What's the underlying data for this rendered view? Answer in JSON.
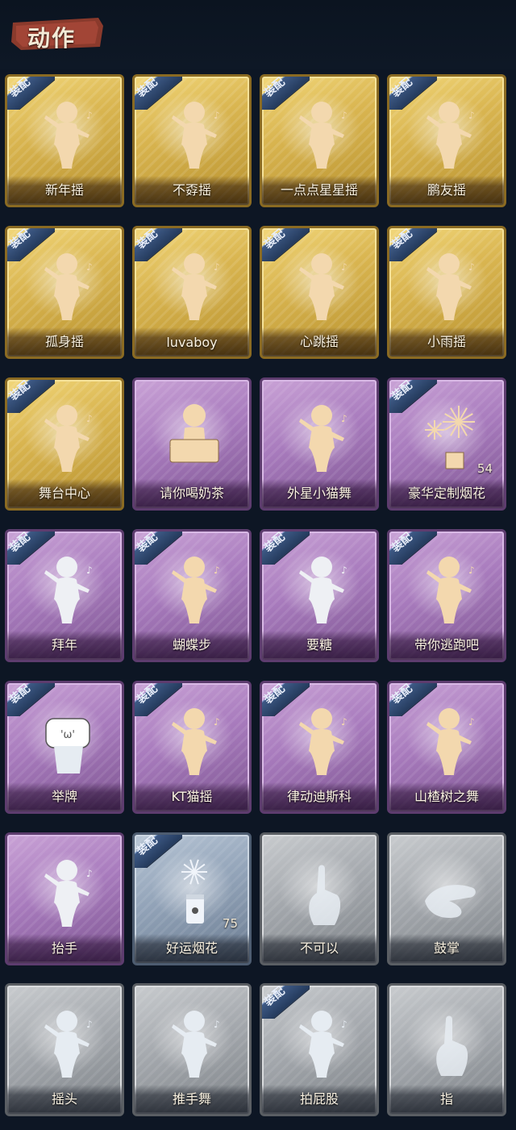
{
  "header": {
    "title": "动作"
  },
  "badge_text": "装配",
  "colors": {
    "gold": "#d9b550",
    "purple": "#a87bbd",
    "blue": "#92a3b8",
    "grey": "#a4a8ad",
    "badge": "#2f4a72",
    "background": "#0d1624"
  },
  "cards": [
    {
      "label": "新年摇",
      "rarity": "gold",
      "equipped": true,
      "icon": "dance-figure-icon",
      "count": ""
    },
    {
      "label": "不孬摇",
      "rarity": "gold",
      "equipped": true,
      "icon": "dance-figure-icon",
      "count": ""
    },
    {
      "label": "一点点星星摇",
      "rarity": "gold",
      "equipped": true,
      "icon": "dance-figure-icon",
      "count": ""
    },
    {
      "label": "鹏友摇",
      "rarity": "gold",
      "equipped": true,
      "icon": "dance-figure-icon",
      "count": ""
    },
    {
      "label": "孤身摇",
      "rarity": "gold",
      "equipped": true,
      "icon": "dance-figure-icon",
      "count": ""
    },
    {
      "label": "luvaboy",
      "rarity": "gold",
      "equipped": true,
      "icon": "dance-figure-icon",
      "count": ""
    },
    {
      "label": "心跳摇",
      "rarity": "gold",
      "equipped": true,
      "icon": "dance-figure-icon",
      "count": ""
    },
    {
      "label": "小雨摇",
      "rarity": "gold",
      "equipped": true,
      "icon": "dance-figure-icon",
      "count": ""
    },
    {
      "label": "舞台中心",
      "rarity": "gold",
      "equipped": true,
      "icon": "dance-figure-icon",
      "count": ""
    },
    {
      "label": "请你喝奶茶",
      "rarity": "purple",
      "equipped": false,
      "icon": "milk-tea-figure-icon",
      "count": ""
    },
    {
      "label": "外星小猫舞",
      "rarity": "purple",
      "equipped": false,
      "icon": "dance-figure-icon",
      "count": ""
    },
    {
      "label": "豪华定制烟花",
      "rarity": "purple",
      "equipped": true,
      "icon": "fireworks-icon",
      "count": "54"
    },
    {
      "label": "拜年",
      "rarity": "purple",
      "equipped": true,
      "icon": "greeting-figure-icon",
      "count": ""
    },
    {
      "label": "蝴蝶步",
      "rarity": "purple",
      "equipped": true,
      "icon": "dance-figure-icon",
      "count": ""
    },
    {
      "label": "要糖",
      "rarity": "purple",
      "equipped": true,
      "icon": "greeting-figure-icon",
      "count": ""
    },
    {
      "label": "带你逃跑吧",
      "rarity": "purple",
      "equipped": true,
      "icon": "dance-figure-icon",
      "count": ""
    },
    {
      "label": "举牌",
      "rarity": "purple",
      "equipped": true,
      "icon": "sign-figure-icon",
      "count": ""
    },
    {
      "label": "KT猫摇",
      "rarity": "purple",
      "equipped": true,
      "icon": "dance-figure-icon",
      "count": ""
    },
    {
      "label": "律动迪斯科",
      "rarity": "purple",
      "equipped": true,
      "icon": "dance-figure-icon",
      "count": ""
    },
    {
      "label": "山楂树之舞",
      "rarity": "purple",
      "equipped": true,
      "icon": "dance-figure-icon",
      "count": ""
    },
    {
      "label": "抬手",
      "rarity": "purple",
      "equipped": false,
      "icon": "greeting-figure-icon",
      "count": ""
    },
    {
      "label": "好运烟花",
      "rarity": "blue",
      "equipped": true,
      "icon": "firework-can-icon",
      "count": "75"
    },
    {
      "label": "不可以",
      "rarity": "grey",
      "equipped": false,
      "icon": "hand-icon",
      "count": ""
    },
    {
      "label": "鼓掌",
      "rarity": "grey",
      "equipped": false,
      "icon": "clap-hands-icon",
      "count": ""
    },
    {
      "label": "摇头",
      "rarity": "grey",
      "equipped": false,
      "icon": "greeting-figure-icon",
      "count": ""
    },
    {
      "label": "推手舞",
      "rarity": "grey",
      "equipped": false,
      "icon": "greeting-figure-icon",
      "count": ""
    },
    {
      "label": "拍屁股",
      "rarity": "grey",
      "equipped": true,
      "icon": "greeting-figure-icon",
      "count": ""
    },
    {
      "label": "指",
      "rarity": "grey",
      "equipped": false,
      "icon": "hand-icon",
      "count": ""
    }
  ]
}
